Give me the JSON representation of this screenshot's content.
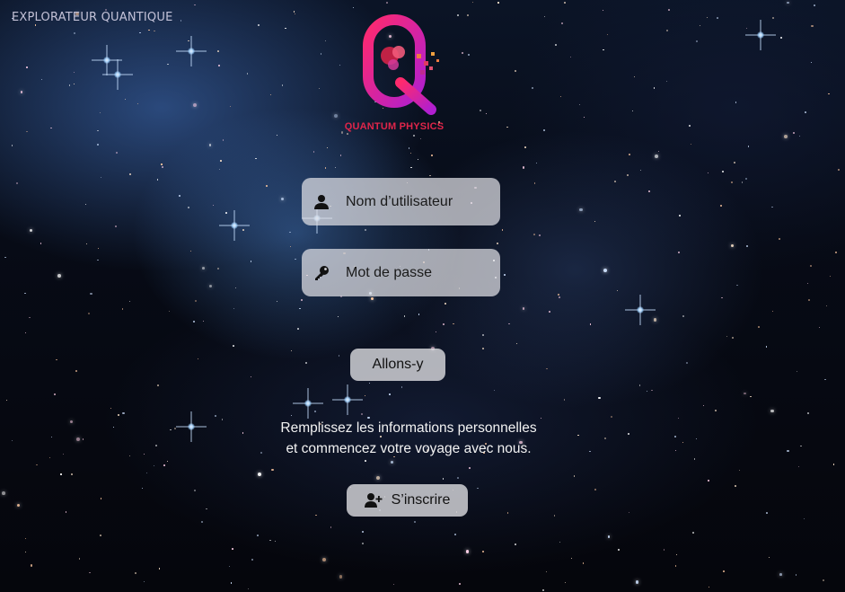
{
  "app": {
    "title": "EXPLORATEUR QUANTIQUE"
  },
  "logo": {
    "name": "QUANTUM PHYSICS",
    "letter": "Q"
  },
  "form": {
    "username_placeholder": "Nom d’utilisateur",
    "password_placeholder": "Mot de passe",
    "submit_label": "Allons-y"
  },
  "info": {
    "line1": "Remplissez les informations personnelles",
    "line2": "et commencez votre voyage avec nous."
  },
  "signup": {
    "label": "S’inscrire"
  },
  "icons": {
    "username": "user-icon",
    "password": "key-icon",
    "signup": "user-plus-icon"
  },
  "colors": {
    "logo_gradient_start": "#e0254a",
    "logo_gradient_end": "#b01fd0",
    "control_background": "#e1e1e6"
  }
}
